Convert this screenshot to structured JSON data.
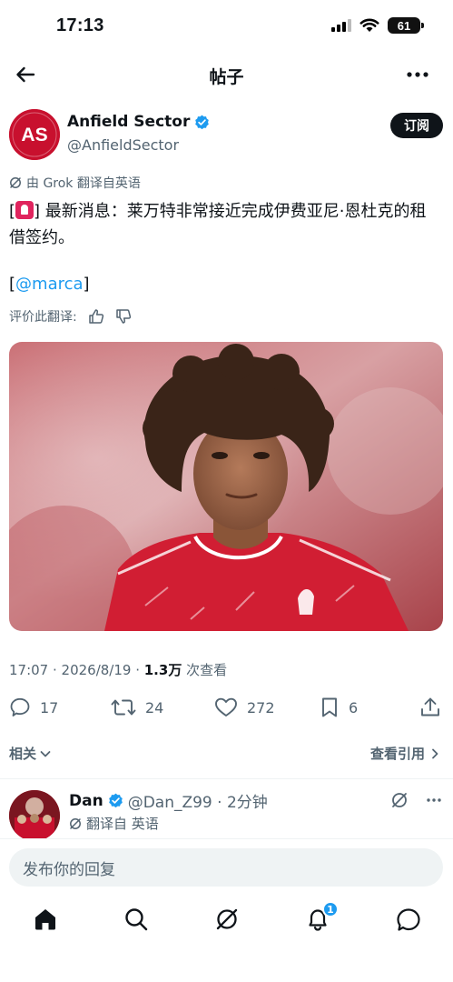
{
  "status": {
    "time": "17:13",
    "battery": "61"
  },
  "nav": {
    "title": "帖子"
  },
  "tweet": {
    "author_name": "Anfield Sector",
    "author_handle": "@AnfieldSector",
    "avatar_text": "AS",
    "follow_label": "订阅",
    "translated_note": "由 Grok 翻译自英语",
    "text_open": "[",
    "text_body": "] 最新消息：莱万特非常接近完成伊费亚尼·恩杜克的租借签约。",
    "mention_open": "[",
    "mention": "@marca",
    "mention_close": "]",
    "rate_label": "评价此翻译:",
    "time": "17:07 · 2026/8/19 · ",
    "views_count": "1.3万",
    "views_label": " 次查看",
    "replies": "17",
    "retweets": "24",
    "likes": "272",
    "bookmarks": "6",
    "related_label": "相关",
    "quotes_label": "查看引用"
  },
  "reply": {
    "name": "Dan",
    "handle_time": "@Dan_Z99 · 2分钟",
    "translated": "翻译自 英语"
  },
  "compose": {
    "placeholder": "发布你的回复"
  },
  "tabbar": {
    "notifications_badge": "1"
  },
  "colors": {
    "accent": "#1d9bf0",
    "text": "#0f1419",
    "muted": "#536471",
    "brand_red": "#c8102e"
  },
  "icons": [
    "back-arrow-icon",
    "more-icon",
    "verified-badge-icon",
    "grok-icon",
    "siren-emoji-icon",
    "thumbs-up-icon",
    "thumbs-down-icon",
    "reply-icon",
    "retweet-icon",
    "like-icon",
    "bookmark-icon",
    "share-icon",
    "chevron-down-icon",
    "chevron-right-icon",
    "home-icon",
    "search-icon",
    "grok-tab-icon",
    "notifications-icon",
    "messages-icon"
  ]
}
